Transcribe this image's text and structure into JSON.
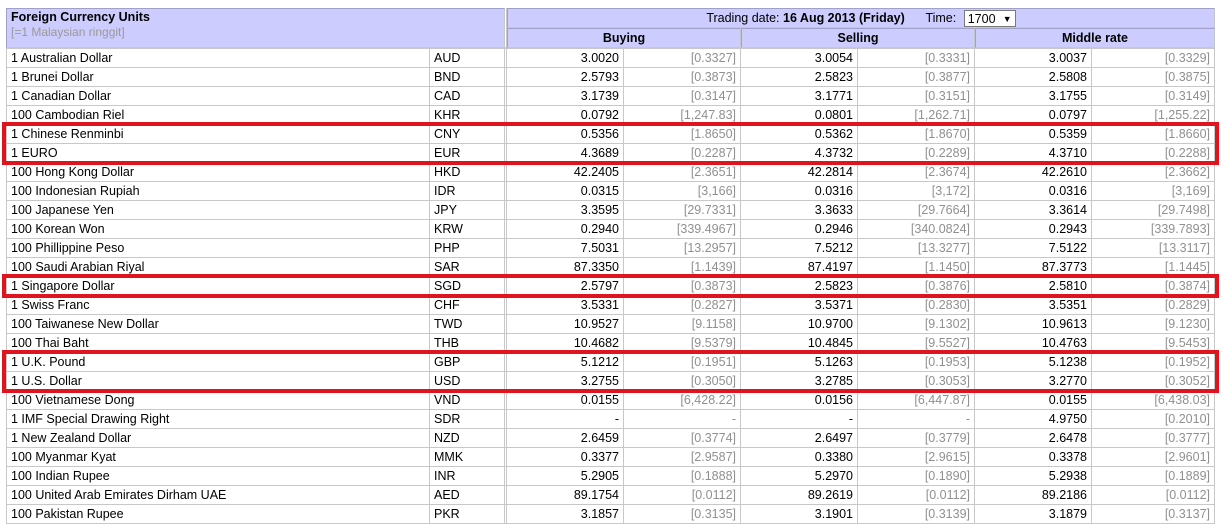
{
  "header": {
    "title": "Foreign Currency Units",
    "subtitle": "[=1 Malaysian ringgit]",
    "trading_label": "Trading date:",
    "trading_date": "16 Aug 2013 (Friday)",
    "time_label": "Time:",
    "time_value": "1700",
    "col_buying": "Buying",
    "col_selling": "Selling",
    "col_middle": "Middle rate"
  },
  "rows": [
    {
      "name": "1 Australian Dollar",
      "code": "AUD",
      "buy": "3.0020",
      "buy_inv": "[0.3327]",
      "sell": "3.0054",
      "sell_inv": "[0.3331]",
      "mid": "3.0037",
      "mid_inv": "[0.3329]"
    },
    {
      "name": "1 Brunei Dollar",
      "code": "BND",
      "buy": "2.5793",
      "buy_inv": "[0.3873]",
      "sell": "2.5823",
      "sell_inv": "[0.3877]",
      "mid": "2.5808",
      "mid_inv": "[0.3875]"
    },
    {
      "name": "1 Canadian Dollar",
      "code": "CAD",
      "buy": "3.1739",
      "buy_inv": "[0.3147]",
      "sell": "3.1771",
      "sell_inv": "[0.3151]",
      "mid": "3.1755",
      "mid_inv": "[0.3149]"
    },
    {
      "name": "100 Cambodian Riel",
      "code": "KHR",
      "buy": "0.0792",
      "buy_inv": "[1,247.83]",
      "sell": "0.0801",
      "sell_inv": "[1,262.71]",
      "mid": "0.0797",
      "mid_inv": "[1,255.22]"
    },
    {
      "name": "1 Chinese Renminbi",
      "code": "CNY",
      "buy": "0.5356",
      "buy_inv": "[1.8650]",
      "sell": "0.5362",
      "sell_inv": "[1.8670]",
      "mid": "0.5359",
      "mid_inv": "[1.8660]"
    },
    {
      "name": "1 EURO",
      "code": "EUR",
      "buy": "4.3689",
      "buy_inv": "[0.2287]",
      "sell": "4.3732",
      "sell_inv": "[0.2289]",
      "mid": "4.3710",
      "mid_inv": "[0.2288]"
    },
    {
      "name": "100 Hong Kong Dollar",
      "code": "HKD",
      "buy": "42.2405",
      "buy_inv": "[2.3651]",
      "sell": "42.2814",
      "sell_inv": "[2.3674]",
      "mid": "42.2610",
      "mid_inv": "[2.3662]"
    },
    {
      "name": "100 Indonesian Rupiah",
      "code": "IDR",
      "buy": "0.0315",
      "buy_inv": "[3,166]",
      "sell": "0.0316",
      "sell_inv": "[3,172]",
      "mid": "0.0316",
      "mid_inv": "[3,169]"
    },
    {
      "name": "100 Japanese Yen",
      "code": "JPY",
      "buy": "3.3595",
      "buy_inv": "[29.7331]",
      "sell": "3.3633",
      "sell_inv": "[29.7664]",
      "mid": "3.3614",
      "mid_inv": "[29.7498]"
    },
    {
      "name": "100 Korean Won",
      "code": "KRW",
      "buy": "0.2940",
      "buy_inv": "[339.4967]",
      "sell": "0.2946",
      "sell_inv": "[340.0824]",
      "mid": "0.2943",
      "mid_inv": "[339.7893]"
    },
    {
      "name": "100 Phillippine Peso",
      "code": "PHP",
      "buy": "7.5031",
      "buy_inv": "[13.2957]",
      "sell": "7.5212",
      "sell_inv": "[13.3277]",
      "mid": "7.5122",
      "mid_inv": "[13.3117]"
    },
    {
      "name": "100 Saudi Arabian Riyal",
      "code": "SAR",
      "buy": "87.3350",
      "buy_inv": "[1.1439]",
      "sell": "87.4197",
      "sell_inv": "[1.1450]",
      "mid": "87.3773",
      "mid_inv": "[1.1445]"
    },
    {
      "name": "1 Singapore Dollar",
      "code": "SGD",
      "buy": "2.5797",
      "buy_inv": "[0.3873]",
      "sell": "2.5823",
      "sell_inv": "[0.3876]",
      "mid": "2.5810",
      "mid_inv": "[0.3874]"
    },
    {
      "name": "1 Swiss Franc",
      "code": "CHF",
      "buy": "3.5331",
      "buy_inv": "[0.2827]",
      "sell": "3.5371",
      "sell_inv": "[0.2830]",
      "mid": "3.5351",
      "mid_inv": "[0.2829]"
    },
    {
      "name": "100 Taiwanese New Dollar",
      "code": "TWD",
      "buy": "10.9527",
      "buy_inv": "[9.1158]",
      "sell": "10.9700",
      "sell_inv": "[9.1302]",
      "mid": "10.9613",
      "mid_inv": "[9.1230]"
    },
    {
      "name": "100 Thai Baht",
      "code": "THB",
      "buy": "10.4682",
      "buy_inv": "[9.5379]",
      "sell": "10.4845",
      "sell_inv": "[9.5527]",
      "mid": "10.4763",
      "mid_inv": "[9.5453]"
    },
    {
      "name": "1 U.K. Pound",
      "code": "GBP",
      "buy": "5.1212",
      "buy_inv": "[0.1951]",
      "sell": "5.1263",
      "sell_inv": "[0.1953]",
      "mid": "5.1238",
      "mid_inv": "[0.1952]"
    },
    {
      "name": "1 U.S. Dollar",
      "code": "USD",
      "buy": "3.2755",
      "buy_inv": "[0.3050]",
      "sell": "3.2785",
      "sell_inv": "[0.3053]",
      "mid": "3.2770",
      "mid_inv": "[0.3052]"
    },
    {
      "name": "100 Vietnamese Dong",
      "code": "VND",
      "buy": "0.0155",
      "buy_inv": "[6,428.22]",
      "sell": "0.0156",
      "sell_inv": "[6,447.87]",
      "mid": "0.0155",
      "mid_inv": "[6,438.03]"
    },
    {
      "name": "1 IMF Special Drawing Right",
      "code": "SDR",
      "buy": "-",
      "buy_inv": "-",
      "sell": "-",
      "sell_inv": "-",
      "mid": "4.9750",
      "mid_inv": "[0.2010]"
    },
    {
      "name": "1 New Zealand Dollar",
      "code": "NZD",
      "buy": "2.6459",
      "buy_inv": "[0.3774]",
      "sell": "2.6497",
      "sell_inv": "[0.3779]",
      "mid": "2.6478",
      "mid_inv": "[0.3777]"
    },
    {
      "name": "100 Myanmar Kyat",
      "code": "MMK",
      "buy": "0.3377",
      "buy_inv": "[2.9587]",
      "sell": "0.3380",
      "sell_inv": "[2.9615]",
      "mid": "0.3378",
      "mid_inv": "[2.9601]"
    },
    {
      "name": "100 Indian Rupee",
      "code": "INR",
      "buy": "5.2905",
      "buy_inv": "[0.1888]",
      "sell": "5.2970",
      "sell_inv": "[0.1890]",
      "mid": "5.2938",
      "mid_inv": "[0.1889]"
    },
    {
      "name": "100 United Arab Emirates Dirham UAE",
      "code": "AED",
      "buy": "89.1754",
      "buy_inv": "[0.0112]",
      "sell": "89.2619",
      "sell_inv": "[0.0112]",
      "mid": "89.2186",
      "mid_inv": "[0.0112]"
    },
    {
      "name": "100 Pakistan Rupee",
      "code": "PKR",
      "buy": "3.1857",
      "buy_inv": "[0.3135]",
      "sell": "3.1901",
      "sell_inv": "[0.3139]",
      "mid": "3.1879",
      "mid_inv": "[0.3137]"
    }
  ],
  "highlighted_codes": [
    "CNY",
    "EUR",
    "SGD",
    "GBP",
    "USD"
  ],
  "colors": {
    "header_bg": "#ccccff",
    "highlight": "#e0141e",
    "inverse_text": "#909090",
    "subtitle_text": "#999999"
  }
}
